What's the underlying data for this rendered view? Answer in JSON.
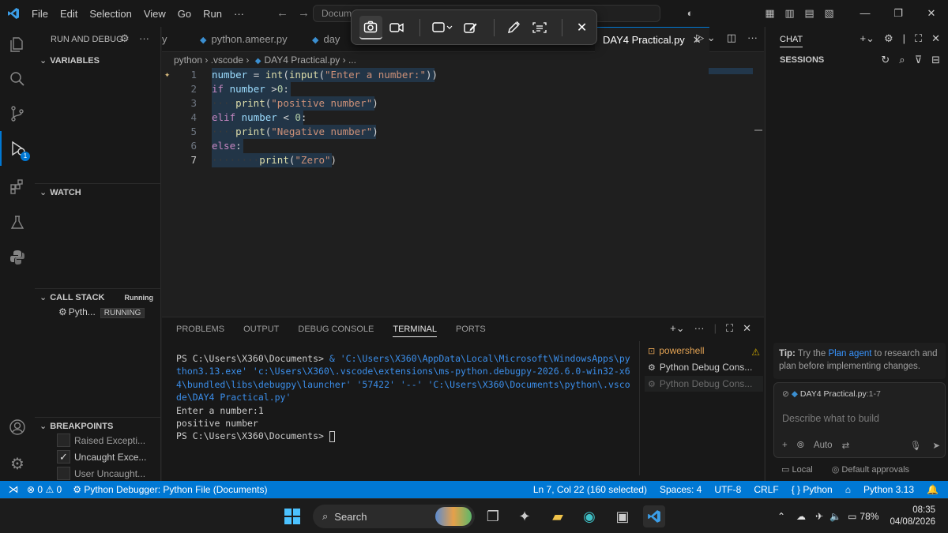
{
  "titlebar": {
    "menu": [
      "File",
      "Edit",
      "Selection",
      "View",
      "Go",
      "Run"
    ],
    "overflow": "···",
    "search_text": "Docume"
  },
  "snip_toolbar": {
    "buttons": [
      "camera-icon",
      "video-icon",
      "rect-snip-icon",
      "edit-icon",
      "pen-icon",
      "text-extract-icon",
      "close-icon"
    ]
  },
  "activity": {
    "debug_badge": "1"
  },
  "sidebar": {
    "title": "RUN AND DEBUG",
    "variables": "VARIABLES",
    "watch": "WATCH",
    "call_stack": "CALL STACK",
    "call_stack_status": "Running",
    "thread_name": "Pyth...",
    "thread_status": "RUNNING",
    "breakpoints": "BREAKPOINTS",
    "breakpoint_items": [
      {
        "label": "Raised Excepti...",
        "checked": false
      },
      {
        "label": "Uncaught Exce...",
        "checked": true
      },
      {
        "label": "User Uncaught...",
        "checked": false
      }
    ]
  },
  "tabs": [
    {
      "label": "y",
      "active": false
    },
    {
      "label": "python.ameer.py",
      "active": false
    },
    {
      "label": "day",
      "active": false
    },
    {
      "label": "DAY4 Practical.py",
      "active": true
    }
  ],
  "breadcrumb": [
    "python",
    ".vscode",
    "DAY4 Practical.py",
    "..."
  ],
  "editor": {
    "line_numbers": [
      "1",
      "2",
      "3",
      "4",
      "5",
      "6",
      "7"
    ],
    "current_line": "7",
    "lines": [
      "number = int(input(\"Enter a number:\"))",
      "if number >0:",
      "    print(\"positive number\")",
      "elif number < 0:",
      "    print(\"Negative number\")",
      "else:",
      "        print(\"Zero\")"
    ]
  },
  "panel": {
    "tabs": [
      "PROBLEMS",
      "OUTPUT",
      "DEBUG CONSOLE",
      "TERMINAL",
      "PORTS"
    ],
    "active_tab": "TERMINAL",
    "terminal": {
      "prompt1": "PS C:\\Users\\X360\\Documents>",
      "command": "& 'C:\\Users\\X360\\AppData\\Local\\Microsoft\\WindowsApps\\python3.13.exe' 'c:\\Users\\X360\\.vscode\\extensions\\ms-python.debugpy-2026.6.0-win32-x64\\bundled\\libs\\debugpy\\launcher' '57422' '--' 'C:\\Users\\X360\\Documents\\python\\.vscode\\DAY4 Practical.py'",
      "out1": "Enter a number:1",
      "out2": "positive number",
      "prompt2": "PS C:\\Users\\X360\\Documents>"
    },
    "terminal_list": [
      "powershell",
      "Python Debug Cons...",
      "Python Debug Cons..."
    ]
  },
  "chat": {
    "title": "CHAT",
    "sessions": "SESSIONS",
    "tip_label": "Tip:",
    "tip_text1": "Try the",
    "tip_link": "Plan agent",
    "tip_text2": "to research and plan before implementing changes.",
    "attachment_name": "DAY4 Practical.py",
    "attachment_range": ":1-7",
    "placeholder": "Describe what to build",
    "mode": "Auto",
    "location": "Local",
    "approvals": "Default approvals"
  },
  "statusbar": {
    "errors": "0",
    "warnings": "0",
    "debug_config": "Python Debugger: Python File (Documents)",
    "position": "Ln 7, Col 22 (160 selected)",
    "spaces": "Spaces: 4",
    "encoding": "UTF-8",
    "eol": "CRLF",
    "language": "Python",
    "interpreter": "Python 3.13"
  },
  "taskbar": {
    "search_label": "Search",
    "battery": "78%",
    "time": "08:35",
    "date": "04/08/2026"
  },
  "colors": {
    "accent": "#0078d4",
    "editor_bg": "#1f1f1f",
    "sidebar_bg": "#181818",
    "terminal_path": "#3b8eea"
  }
}
